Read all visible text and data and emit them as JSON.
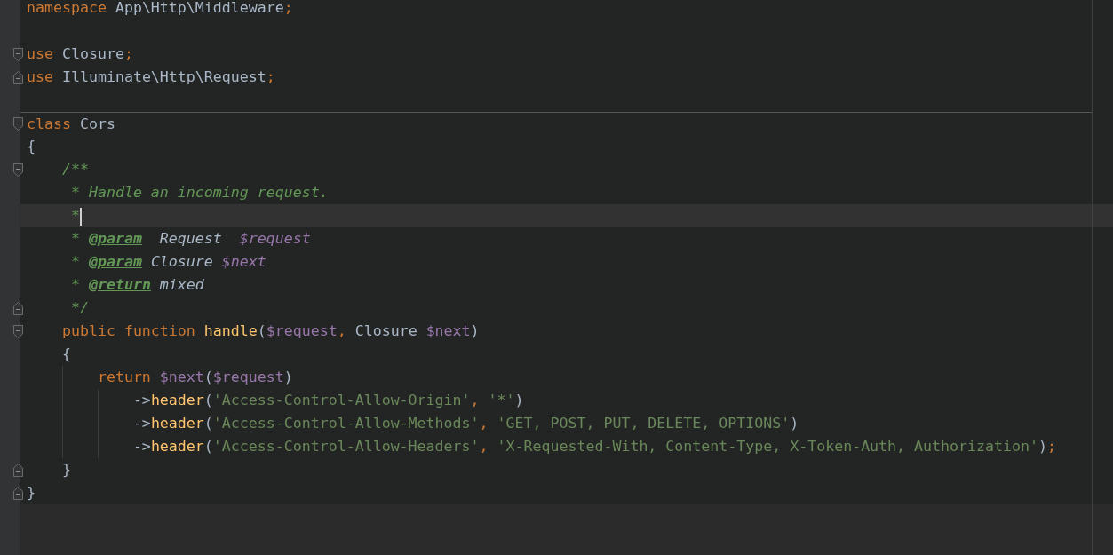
{
  "editor": {
    "lines": [
      {
        "tokens": [
          {
            "kind": "keyword",
            "text": "namespace "
          },
          {
            "kind": "plain",
            "text": "App\\Http\\Middleware"
          },
          {
            "kind": "keyword",
            "text": ";"
          }
        ]
      },
      {
        "blank_line_above": true,
        "fold_start": true,
        "tokens": [
          {
            "kind": "keyword",
            "text": "use "
          },
          {
            "kind": "plain",
            "text": "Closure"
          },
          {
            "kind": "keyword",
            "text": ";"
          }
        ]
      },
      {
        "fold_end": true,
        "tokens": [
          {
            "kind": "keyword",
            "text": "use "
          },
          {
            "kind": "plain",
            "text": "Illuminate\\Http\\Request"
          },
          {
            "kind": "keyword",
            "text": ";"
          }
        ]
      },
      {
        "blank_line_above": true,
        "separator": true,
        "fold_start": true,
        "tokens": [
          {
            "kind": "keyword",
            "text": "class "
          },
          {
            "kind": "plain",
            "text": "Cors"
          }
        ]
      },
      {
        "tokens": [
          {
            "kind": "plain",
            "text": "{"
          }
        ]
      },
      {
        "fold_start": true,
        "tokens": [
          {
            "kind": "comment",
            "text": "    /**"
          }
        ]
      },
      {
        "tokens": [
          {
            "kind": "comment",
            "text": "     * Handle an incoming request."
          }
        ]
      },
      {
        "current": true,
        "tokens": [
          {
            "kind": "comment",
            "text": "     *"
          }
        ]
      },
      {
        "tokens": [
          {
            "kind": "comment",
            "text": "     * "
          },
          {
            "kind": "doctag",
            "text": "@param"
          },
          {
            "kind": "doctype",
            "text": "  Request  "
          },
          {
            "kind": "docvar",
            "text": "$request"
          }
        ]
      },
      {
        "tokens": [
          {
            "kind": "comment",
            "text": "     * "
          },
          {
            "kind": "doctag",
            "text": "@param"
          },
          {
            "kind": "doctype",
            "text": " Closure "
          },
          {
            "kind": "docvar",
            "text": "$next"
          }
        ]
      },
      {
        "tokens": [
          {
            "kind": "comment",
            "text": "     * "
          },
          {
            "kind": "doctag",
            "text": "@return"
          },
          {
            "kind": "doctype",
            "text": " mixed"
          }
        ]
      },
      {
        "fold_end": true,
        "tokens": [
          {
            "kind": "comment",
            "text": "     */"
          }
        ]
      },
      {
        "fold_start": true,
        "tokens": [
          {
            "kind": "keyword",
            "text": "    public function "
          },
          {
            "kind": "func",
            "text": "handle"
          },
          {
            "kind": "plain",
            "text": "("
          },
          {
            "kind": "var",
            "text": "$request"
          },
          {
            "kind": "keyword",
            "text": ", "
          },
          {
            "kind": "plain",
            "text": "Closure "
          },
          {
            "kind": "var",
            "text": "$next"
          },
          {
            "kind": "plain",
            "text": ")"
          }
        ]
      },
      {
        "tokens": [
          {
            "kind": "plain",
            "text": "    {"
          }
        ]
      },
      {
        "tokens": [
          {
            "kind": "keyword",
            "text": "        return "
          },
          {
            "kind": "var",
            "text": "$next"
          },
          {
            "kind": "plain",
            "text": "("
          },
          {
            "kind": "var",
            "text": "$request"
          },
          {
            "kind": "plain",
            "text": ")"
          }
        ]
      },
      {
        "tokens": [
          {
            "kind": "plain",
            "text": "            ->"
          },
          {
            "kind": "func",
            "text": "header"
          },
          {
            "kind": "plain",
            "text": "("
          },
          {
            "kind": "string",
            "text": "'Access-Control-Allow-Origin'"
          },
          {
            "kind": "keyword",
            "text": ", "
          },
          {
            "kind": "string",
            "text": "'*'"
          },
          {
            "kind": "plain",
            "text": ")"
          }
        ]
      },
      {
        "tokens": [
          {
            "kind": "plain",
            "text": "            ->"
          },
          {
            "kind": "func",
            "text": "header"
          },
          {
            "kind": "plain",
            "text": "("
          },
          {
            "kind": "string",
            "text": "'Access-Control-Allow-Methods'"
          },
          {
            "kind": "keyword",
            "text": ", "
          },
          {
            "kind": "string",
            "text": "'GET, POST, PUT, DELETE, OPTIONS'"
          },
          {
            "kind": "plain",
            "text": ")"
          }
        ]
      },
      {
        "tokens": [
          {
            "kind": "plain",
            "text": "            ->"
          },
          {
            "kind": "func",
            "text": "header"
          },
          {
            "kind": "plain",
            "text": "("
          },
          {
            "kind": "string",
            "text": "'Access-Control-Allow-Headers'"
          },
          {
            "kind": "keyword",
            "text": ", "
          },
          {
            "kind": "string",
            "text": "'X-Requested-With, Content-Type, X-Token-Auth, Authorization'"
          },
          {
            "kind": "plain",
            "text": ")"
          },
          {
            "kind": "keyword",
            "text": ";"
          }
        ]
      },
      {
        "fold_end": true,
        "tokens": [
          {
            "kind": "plain",
            "text": "    }"
          }
        ]
      },
      {
        "fold_end": true,
        "tokens": [
          {
            "kind": "plain",
            "text": "}"
          }
        ]
      }
    ]
  }
}
